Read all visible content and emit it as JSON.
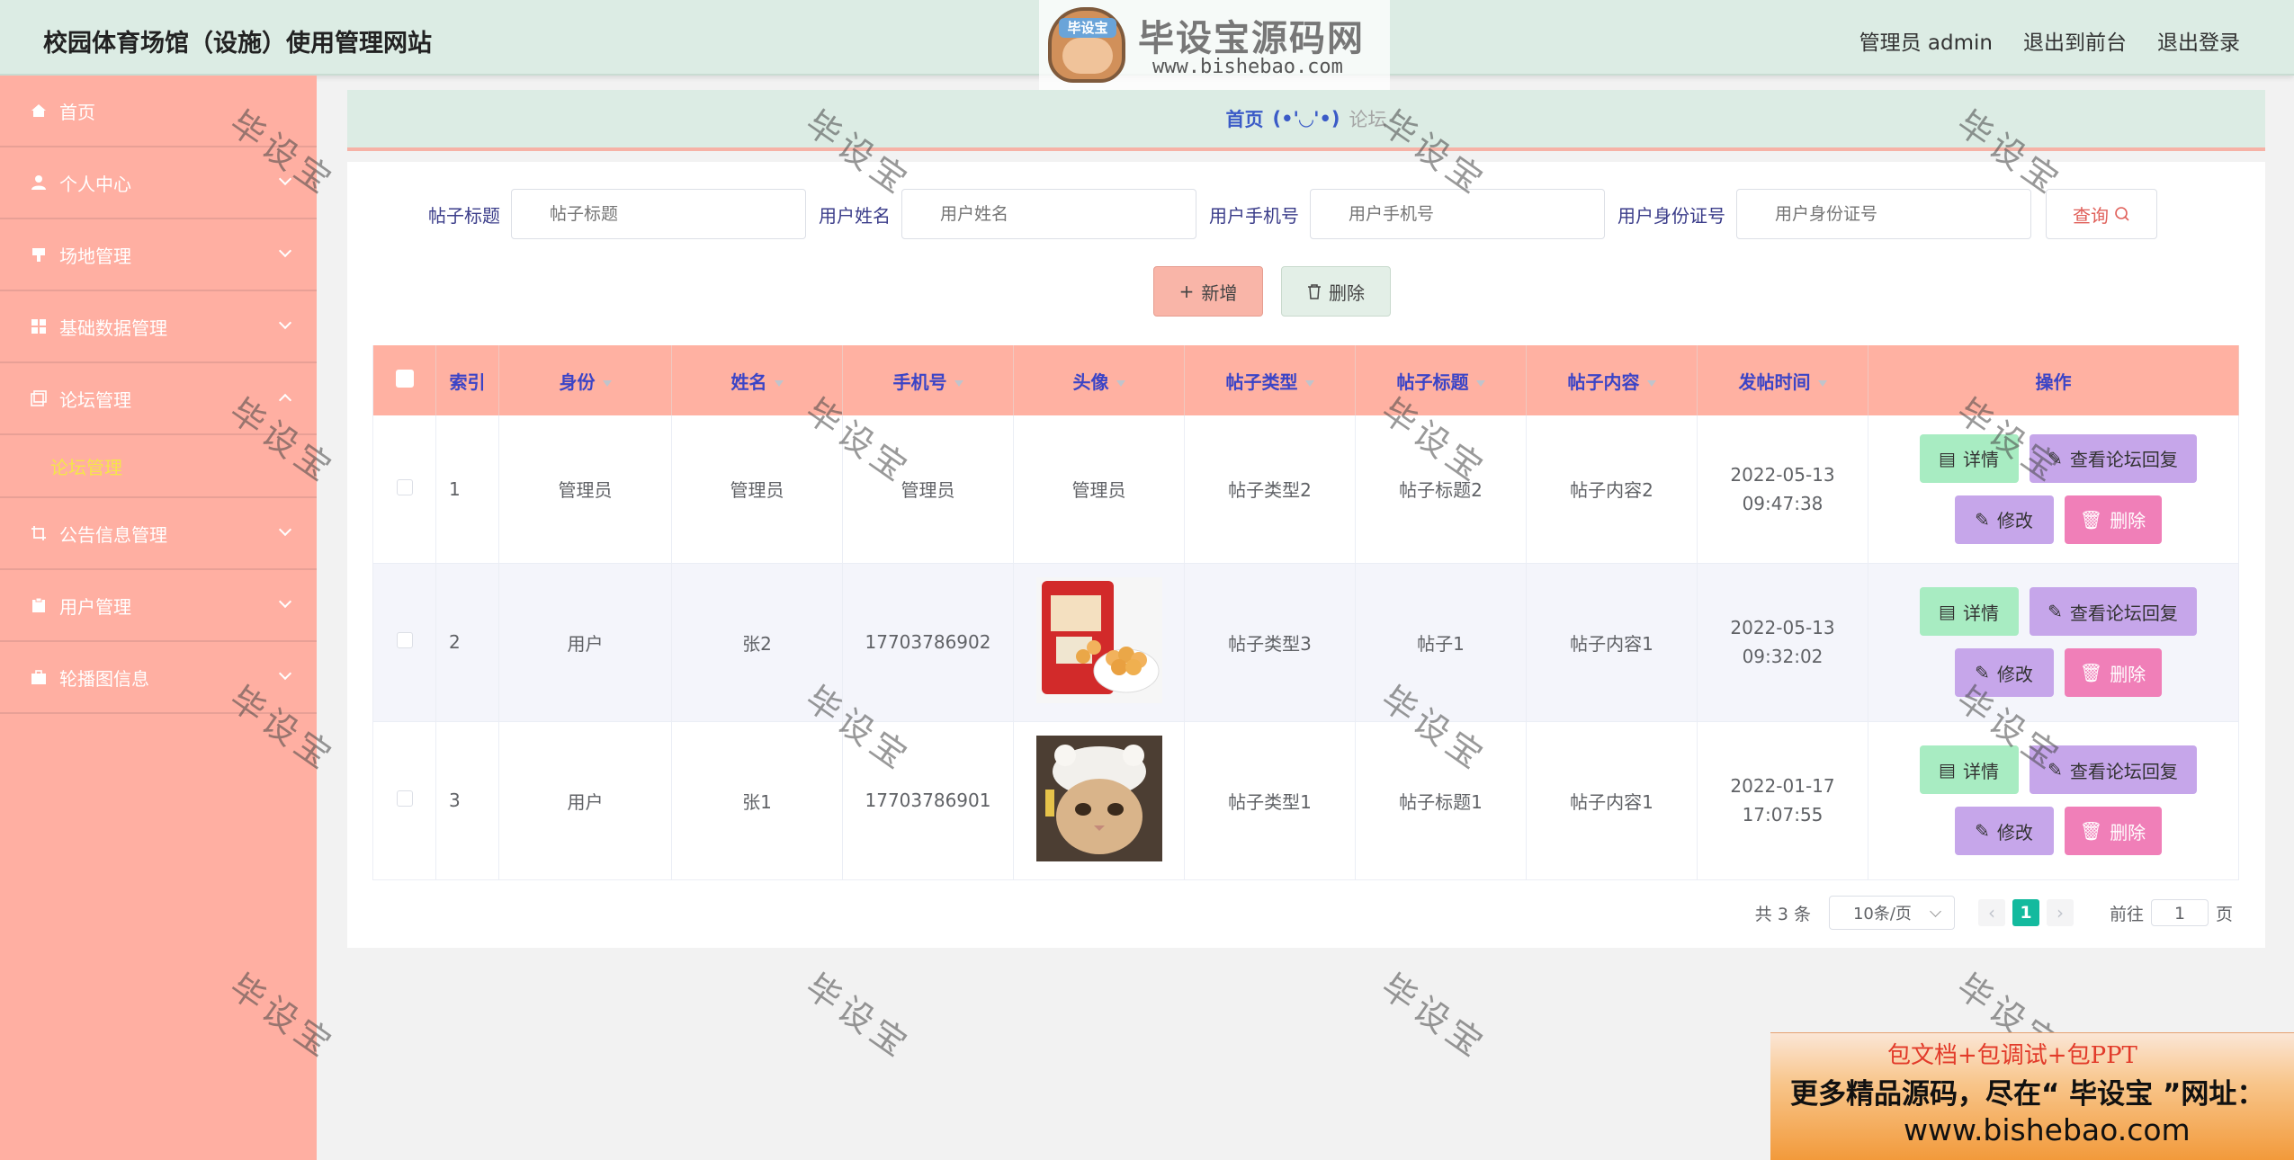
{
  "header": {
    "site_title": "校园体育场馆（设施）使用管理网站",
    "admin_label": "管理员 admin",
    "back_label": "退出到前台",
    "logout_label": "退出登录"
  },
  "watermark_logo": {
    "badge_text": "毕设宝",
    "name": "毕设宝源码网",
    "url": "www.bishebao.com"
  },
  "sidebar": {
    "items": [
      {
        "label": "首页",
        "icon": "home-icon"
      },
      {
        "label": "个人中心",
        "icon": "user-icon"
      },
      {
        "label": "场地管理",
        "icon": "venue-icon"
      },
      {
        "label": "基础数据管理",
        "icon": "grid-icon"
      },
      {
        "label": "论坛管理",
        "icon": "forum-icon",
        "expanded": true
      },
      {
        "label": "公告信息管理",
        "icon": "crop-icon"
      },
      {
        "label": "用户管理",
        "icon": "clipboard-icon"
      },
      {
        "label": "轮播图信息",
        "icon": "briefcase-icon"
      }
    ],
    "active_sub": "论坛管理"
  },
  "breadcrumb": {
    "home": "首页",
    "face": "(•'◡'•)",
    "current": "论坛"
  },
  "search": {
    "fields": [
      {
        "label": "帖子标题",
        "placeholder": "帖子标题"
      },
      {
        "label": "用户姓名",
        "placeholder": "用户姓名"
      },
      {
        "label": "用户手机号",
        "placeholder": "用户手机号"
      },
      {
        "label": "用户身份证号",
        "placeholder": "用户身份证号"
      }
    ],
    "query_label": "查询"
  },
  "actions": {
    "add_label": "新增",
    "delete_label": "删除"
  },
  "table": {
    "columns": [
      "索引",
      "身份",
      "姓名",
      "手机号",
      "头像",
      "帖子类型",
      "帖子标题",
      "帖子内容",
      "发帖时间",
      "操作"
    ],
    "rows": [
      {
        "index": "1",
        "role": "管理员",
        "name": "管理员",
        "phone": "管理员",
        "avatar": "管理员",
        "type": "帖子类型2",
        "title": "帖子标题2",
        "content": "帖子内容2",
        "time": "2022-05-13 09:47:38"
      },
      {
        "index": "2",
        "role": "用户",
        "name": "张2",
        "phone": "17703786902",
        "avatar": "",
        "type": "帖子类型3",
        "title": "帖子1",
        "content": "帖子内容1",
        "time": "2022-05-13 09:32:02"
      },
      {
        "index": "3",
        "role": "用户",
        "name": "张1",
        "phone": "17703786901",
        "avatar": "",
        "type": "帖子类型1",
        "title": "帖子标题1",
        "content": "帖子内容1",
        "time": "2022-01-17 17:07:55"
      }
    ],
    "op_labels": {
      "detail": "详情",
      "reply": "查看论坛回复",
      "edit": "修改",
      "remove": "删除"
    }
  },
  "pagination": {
    "total": "共 3 条",
    "page_size": "10条/页",
    "current_page": "1",
    "goto_label": "前往",
    "goto_value": "1",
    "page_suffix": "页"
  },
  "watermark_text": "毕设宝",
  "ad": {
    "line1": "包文档+包调试+包PPT",
    "line2": "更多精品源码，尽在“ 毕设宝 ”网址：",
    "line3": "www.bishebao.com"
  },
  "colors": {
    "sidebar": "#ffafa2",
    "header": "#dcece4",
    "table_head": "#ffb1a2",
    "accent_text": "#3b44c6",
    "detail_btn": "#a8ecc2",
    "reply_btn": "#c6a6ea",
    "remove_btn": "#f07fb8",
    "pager_active": "#13ba9e"
  }
}
